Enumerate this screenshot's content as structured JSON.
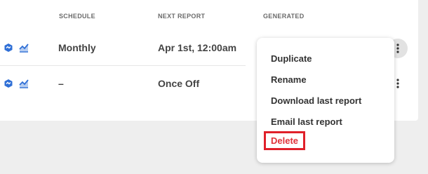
{
  "table": {
    "headers": {
      "schedule": "SCHEDULE",
      "next_report": "NEXT REPORT",
      "generated": "GENERATED"
    },
    "rows": [
      {
        "schedule": "Monthly",
        "next_report": "Apr 1st, 12:00am",
        "icons": [
          "report-type-icon",
          "chart-icon"
        ]
      },
      {
        "schedule": "–",
        "next_report": "Once Off",
        "icons": [
          "report-type-icon",
          "chart-icon"
        ]
      }
    ]
  },
  "context_menu": {
    "items": [
      "Duplicate",
      "Rename",
      "Download last report",
      "Email last report",
      "Delete"
    ]
  },
  "colors": {
    "icon_blue": "#2f6fd6",
    "danger": "#e0323a",
    "background": "#eeeeee"
  }
}
